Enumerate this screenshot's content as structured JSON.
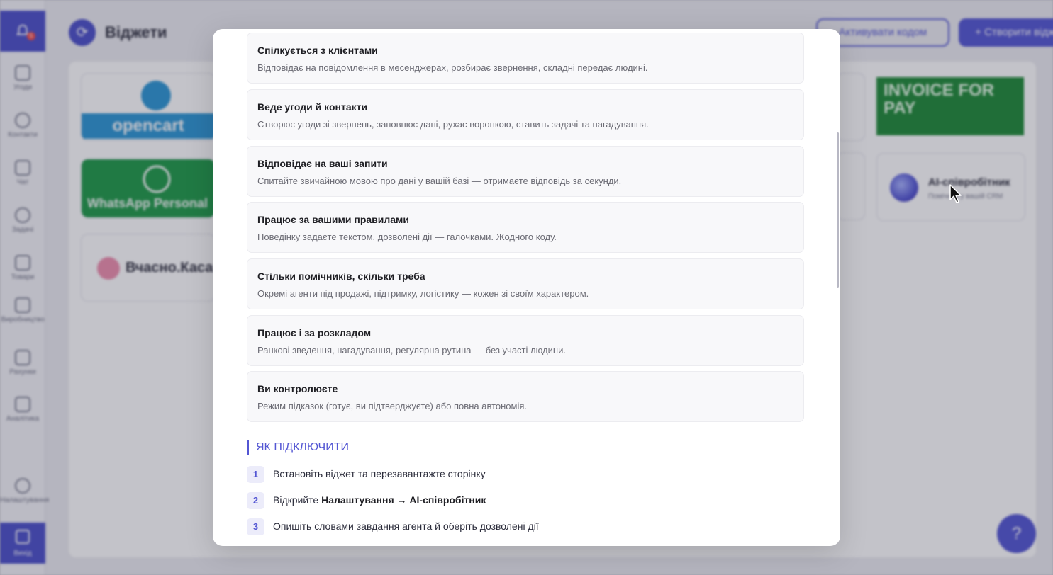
{
  "background": {
    "page_title": "Віджети",
    "notification_count": "5",
    "header_buttons": {
      "code": "Активувати кодом",
      "create": "+ Створити віджет"
    },
    "sidebar": [
      {
        "label": "Угоди",
        "icon": "deals-icon"
      },
      {
        "label": "Контакти",
        "icon": "contacts-icon"
      },
      {
        "label": "Чат",
        "icon": "chat-icon"
      },
      {
        "label": "Задачі",
        "icon": "tasks-icon"
      },
      {
        "label": "Товари",
        "icon": "products-icon"
      },
      {
        "label": "Виробництво",
        "icon": "production-icon"
      },
      {
        "label": "Рахунки",
        "icon": "invoices-icon"
      },
      {
        "label": "Аналітика",
        "icon": "analytics-icon"
      },
      {
        "label": "Налаштування",
        "icon": "settings-icon"
      }
    ],
    "logout": "Вихід",
    "tiles": {
      "opencart": "opencart",
      "whatsapp": "WhatsApp Personal",
      "vchasno": "Вчасно.Каса",
      "invoice": "INVOICE FOR PAY",
      "ai_title": "AI-співробітник",
      "ai_sub": "Помічник у вашій CRM"
    }
  },
  "modal": {
    "features": [
      {
        "title": "Спілкується з клієнтами",
        "desc": "Відповідає на повідомлення в месенджерах, розбирає звернення, складні передає людині."
      },
      {
        "title": "Веде угоди й контакти",
        "desc": "Створює угоди зі звернень, заповнює дані, рухає воронкою, ставить задачі та нагадування."
      },
      {
        "title": "Відповідає на ваші запити",
        "desc": "Спитайте звичайною мовою про дані у вашій базі — отримаєте відповідь за секунди."
      },
      {
        "title": "Працює за вашими правилами",
        "desc": "Поведінку задаєте текстом, дозволені дії — галочками. Жодного коду."
      },
      {
        "title": "Стільки помічників, скільки треба",
        "desc": "Окремі агенти під продажі, підтримку, логістику — кожен зі своїм характером."
      },
      {
        "title": "Працює і за розкладом",
        "desc": "Ранкові зведення, нагадування, регулярна рутина — без участі людини."
      },
      {
        "title": "Ви контролюєте",
        "desc": "Режим підказок (готує, ви підтверджуєте) або повна автономія."
      }
    ],
    "howto_heading": "ЯК ПІДКЛЮЧИТИ",
    "steps": [
      {
        "num": "1",
        "text": "Встановіть віджет та перезавантажте сторінку",
        "bold": ""
      },
      {
        "num": "2",
        "text": "Відкрийте ",
        "bold": "Налаштування → AI-співробітник"
      },
      {
        "num": "3",
        "text": "Опишіть словами завдання агента й оберіть дозволені дії",
        "bold": ""
      }
    ]
  }
}
